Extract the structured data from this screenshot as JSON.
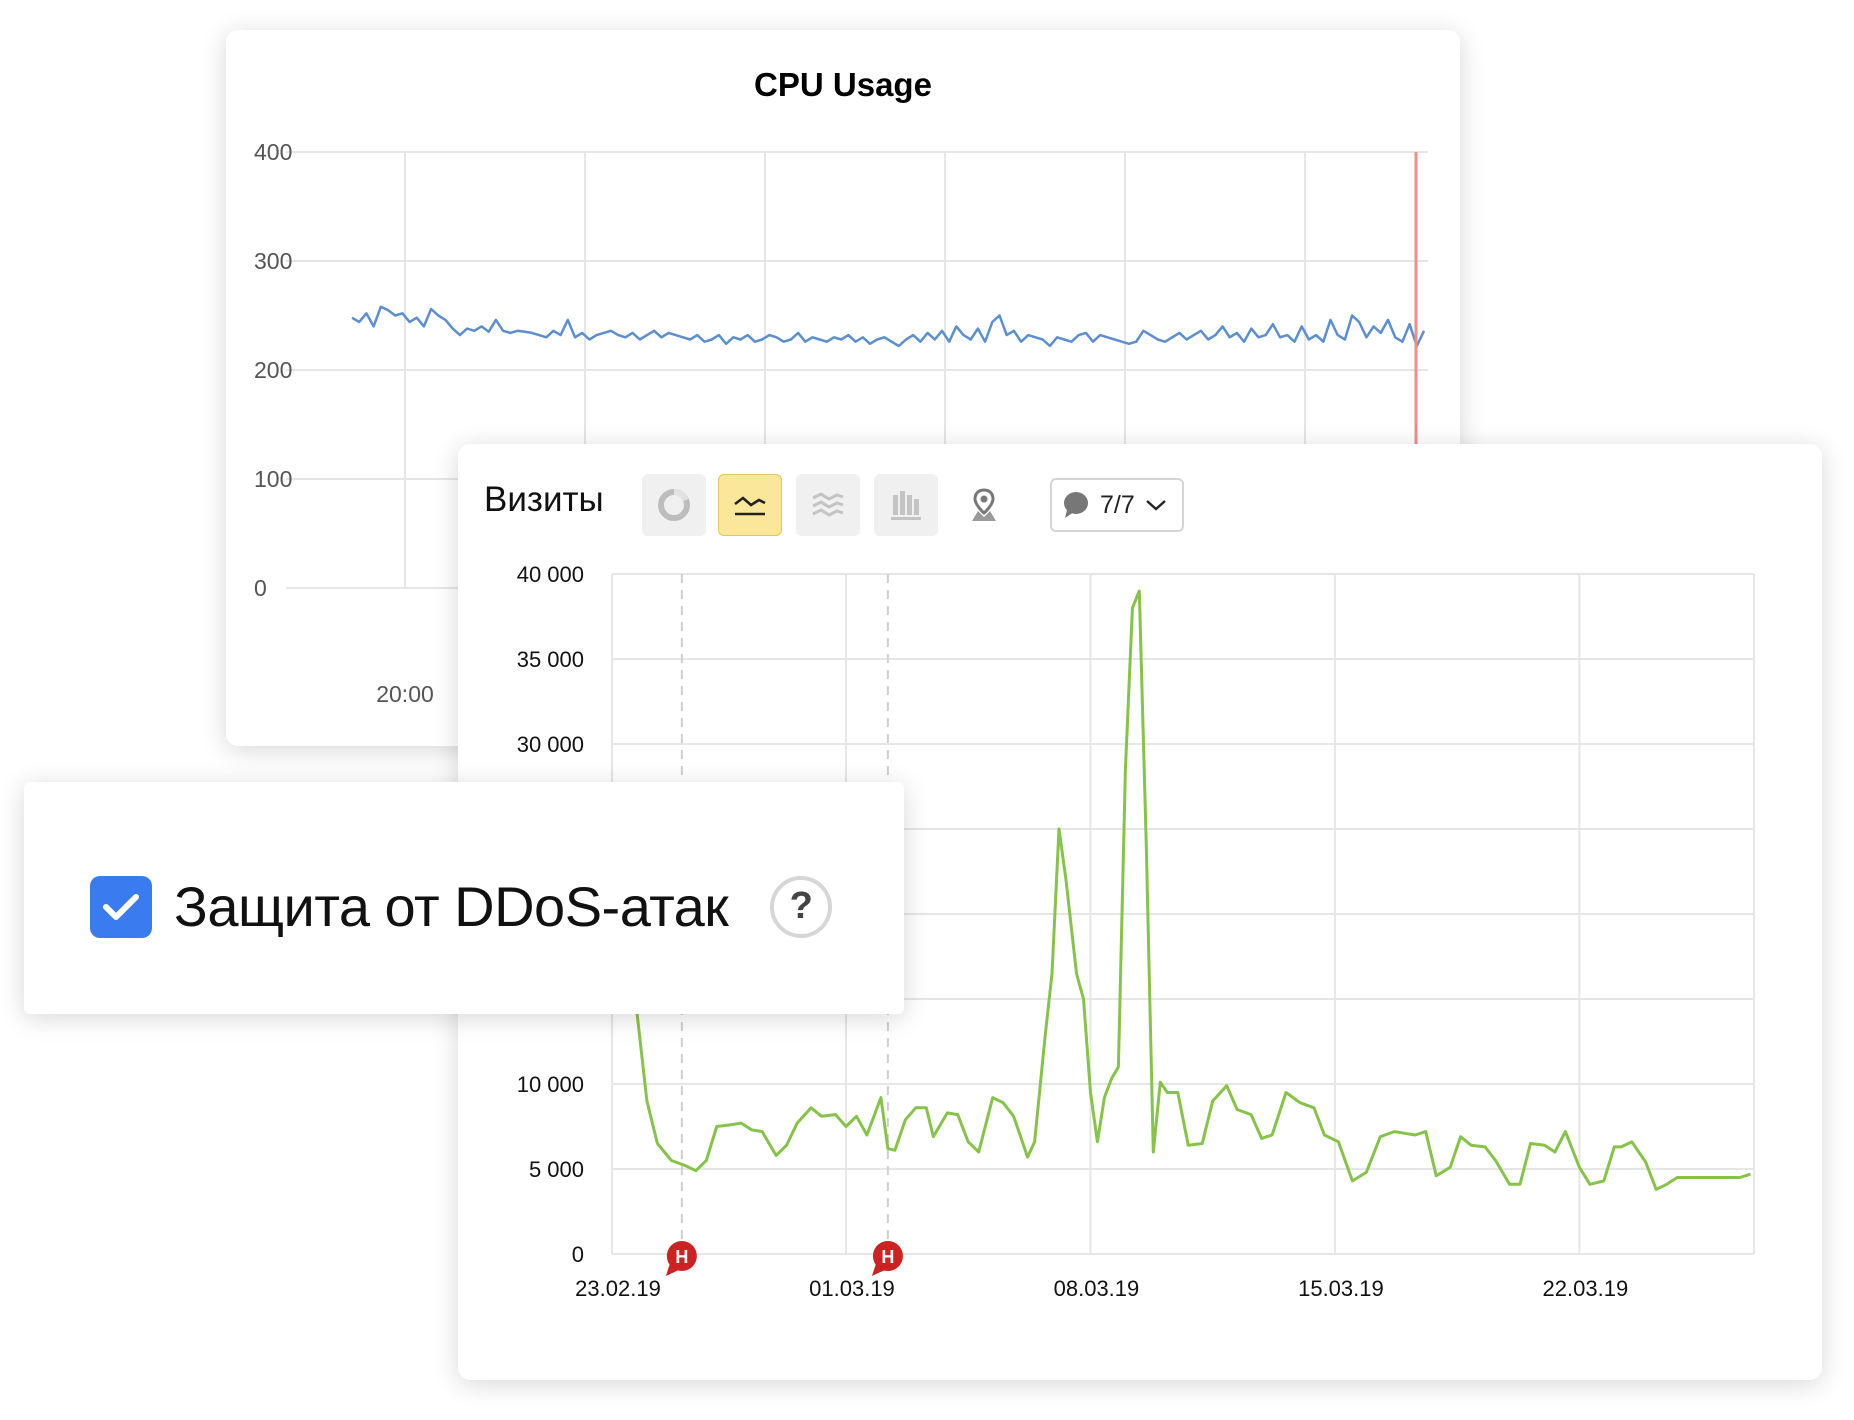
{
  "cpu_panel": {
    "title": "CPU Usage",
    "y_ticks": [
      "400",
      "300",
      "200",
      "100",
      "0"
    ],
    "x_tick": "20:00",
    "line_color": "#5b8fd1",
    "marker_color": "#f28b8b"
  },
  "visits_panel": {
    "title": "Визиты",
    "toolbar_icons": [
      "pie-chart-icon",
      "line-chart-icon",
      "stacked-area-icon",
      "bar-chart-icon",
      "geo-map-icon"
    ],
    "active_icon": "line-chart-icon",
    "notes_button": {
      "icon": "speech-bubble-icon",
      "label": "7/7"
    },
    "line_color": "#86c448",
    "holiday_marker": {
      "label": "Н",
      "color": "#cc2222"
    },
    "holiday_date_color": "#cc2222"
  },
  "ddos_panel": {
    "label": "Защита от DDoS-атак",
    "checked": true,
    "checkbox_color": "#3a7bf0",
    "help_label": "?"
  },
  "chart_data": [
    {
      "type": "line",
      "title": "CPU Usage",
      "ylim": [
        0,
        400
      ],
      "yticks": [
        0,
        100,
        200,
        300,
        400
      ],
      "xticks_visible": [
        "20:00"
      ],
      "grid": true,
      "series": [
        {
          "values": [
            248,
            244,
            252,
            240,
            258,
            255,
            250,
            252,
            244,
            248,
            240,
            256,
            250,
            246,
            238,
            232,
            238,
            236,
            240,
            235,
            246,
            236,
            234,
            236,
            235,
            234,
            232,
            230,
            236,
            232,
            246,
            230,
            234,
            228,
            232,
            234,
            236,
            232,
            230,
            234,
            228,
            232,
            236,
            230,
            234,
            232,
            230,
            228,
            232,
            226,
            228,
            232,
            224,
            230,
            228,
            232,
            226,
            228,
            232,
            230,
            226,
            228,
            234,
            226,
            230,
            228,
            226,
            230,
            228,
            232,
            226,
            230,
            224,
            228,
            230,
            226,
            222,
            228,
            232,
            226,
            234,
            228,
            236,
            226,
            240,
            232,
            228,
            238,
            226,
            244,
            250,
            232,
            236,
            226,
            232,
            230,
            228,
            222,
            230,
            228,
            226,
            232,
            234,
            226,
            232,
            230,
            228,
            226,
            224,
            226,
            236,
            232,
            228,
            226,
            230,
            234,
            228,
            232,
            236,
            228,
            232,
            240,
            230,
            234,
            226,
            238,
            230,
            232,
            242,
            230,
            232,
            226,
            240,
            228,
            232,
            226,
            246,
            232,
            228,
            250,
            244,
            230,
            240,
            234,
            246,
            230,
            226,
            242,
            222,
            236
          ]
        }
      ]
    },
    {
      "type": "line",
      "ylim": [
        0,
        40000
      ],
      "yticks_visible": [
        "0",
        "5 000",
        "10 000",
        "30 000",
        "35 000",
        "40 000"
      ],
      "x_labels": [
        "23.02.19",
        "01.03.19",
        "08.03.19",
        "15.03.19",
        "22.03.19"
      ],
      "highlighted_x_label": "01.03.19",
      "holiday_markers": [
        "24.02.19",
        "01.03.19"
      ],
      "grid": true,
      "series": [
        {
          "x": [
            22.3,
            23.0,
            23.3,
            23.6,
            24.0,
            24.4,
            24.7,
            25.0,
            25.3,
            25.7,
            26.0,
            26.3,
            26.6,
            27.0,
            27.3,
            27.6,
            28.0,
            28.3,
            28.7,
            29.0,
            29.3,
            29.6,
            30.0,
            30.2,
            30.4,
            30.7,
            31.0,
            31.3,
            31.5,
            31.9,
            32.2,
            32.5,
            32.8,
            33.2,
            33.5,
            33.8,
            34.2,
            34.4,
            34.7,
            34.9,
            35.1,
            35.3,
            35.6,
            35.8,
            36.0,
            36.2,
            36.4,
            36.6,
            36.8,
            37.0,
            37.2,
            37.4,
            37.5,
            37.6,
            37.8,
            38.0,
            38.2,
            38.5,
            38.8,
            39.2,
            39.5,
            39.9,
            40.2,
            40.6,
            40.9,
            41.2,
            41.6,
            42.0,
            42.4,
            42.7,
            43.1,
            43.5,
            43.9,
            44.3,
            44.7,
            45.0,
            45.3,
            45.6,
            45.9,
            46.3,
            46.6,
            46.9,
            47.3,
            47.6,
            48.0,
            48.3,
            48.6,
            49.0,
            49.3,
            49.6,
            50.0,
            50.3,
            50.7,
            51.0,
            51.2,
            51.5,
            51.9,
            52.2,
            52.5,
            52.8,
            53.2,
            53.5,
            53.9,
            54.3,
            54.6,
            54.9
          ],
          "values": [
            17000,
            14500,
            9000,
            6500,
            5500,
            5200,
            4900,
            5500,
            7500,
            7600,
            7700,
            7300,
            7200,
            5800,
            6400,
            7700,
            8600,
            8100,
            8200,
            7500,
            8100,
            7000,
            9200,
            6200,
            6100,
            7900,
            8600,
            8600,
            6900,
            8300,
            8200,
            6600,
            6000,
            9200,
            8900,
            8100,
            5700,
            6600,
            12800,
            16500,
            25000,
            22000,
            16500,
            15000,
            9500,
            6600,
            9200,
            10300,
            11000,
            28500,
            38000,
            39000,
            31500,
            24000,
            6000,
            10100,
            9500,
            9500,
            6400,
            6500,
            9000,
            9900,
            8500,
            8200,
            6800,
            7000,
            9500,
            8900,
            8600,
            7000,
            6600,
            4300,
            4800,
            6900,
            7200,
            7100,
            7000,
            7200,
            4600,
            5100,
            6900,
            6400,
            6300,
            5500,
            4100,
            4100,
            6500,
            6400,
            6000,
            7200,
            5100,
            4100,
            4300,
            6300,
            6300,
            6600,
            5400,
            3800,
            4100,
            4500,
            4500,
            4500,
            4500,
            4500,
            4500,
            4700
          ]
        }
      ]
    }
  ]
}
